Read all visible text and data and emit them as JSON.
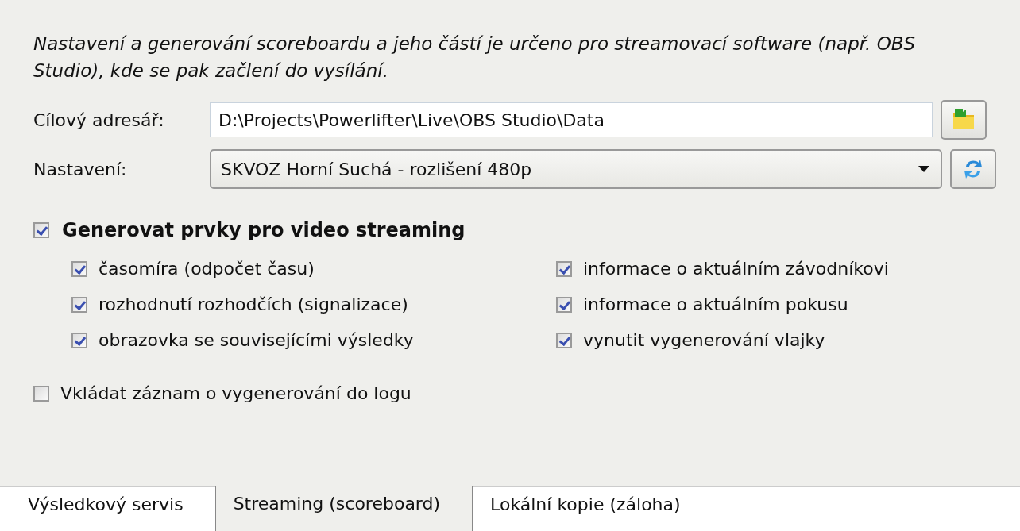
{
  "description": "Nastavení a generování scoreboardu a jeho částí je určeno pro streamovací software (např. OBS Studio), kde se pak začlení do vysílání.",
  "target_dir": {
    "label": "Cílový adresář:",
    "value": "D:\\Projects\\Powerlifter\\Live\\OBS Studio\\Data"
  },
  "settings": {
    "label": "Nastavení:",
    "value": "SKVOZ Horní Suchá - rozlišení 480p"
  },
  "generate": {
    "label": "Generovat prvky pro video streaming",
    "checked": true
  },
  "options": [
    {
      "label": "časomíra (odpočet času)",
      "checked": true
    },
    {
      "label": "informace o aktuálním závodníkovi",
      "checked": true
    },
    {
      "label": "rozhodnutí rozhodčích (signalizace)",
      "checked": true
    },
    {
      "label": "informace o aktuálním pokusu",
      "checked": true
    },
    {
      "label": "obrazovka se souvisejícími výsledky",
      "checked": true
    },
    {
      "label": "vynutit vygenerování vlajky",
      "checked": true
    }
  ],
  "log": {
    "label": "Vkládat záznam o vygenerování do logu",
    "checked": false
  },
  "tabs": [
    {
      "label": "Výsledkový servis",
      "selected": false
    },
    {
      "label": "Streaming (scoreboard)",
      "selected": true
    },
    {
      "label": "Lokální kopie (záloha)",
      "selected": false
    }
  ]
}
